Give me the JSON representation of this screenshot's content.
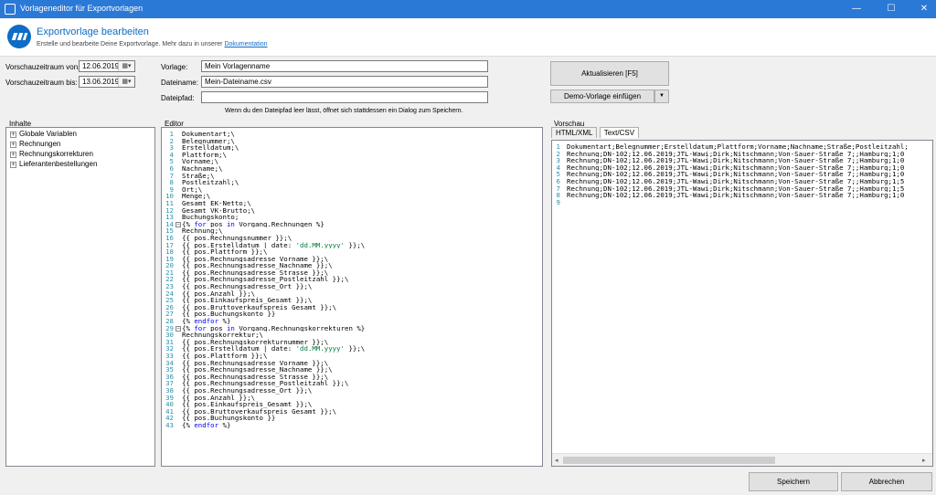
{
  "window": {
    "title": "Vorlageneditor für Exportvorlagen",
    "minimize": "—",
    "maximize": "☐",
    "close": "✕"
  },
  "header": {
    "title": "Exportvorlage bearbeiten",
    "subtitle": "Erstelle und bearbeite Deine Exportvorlage. Mehr dazu in unserer",
    "link": "Dokumentation",
    "brand_color": "#0e6cc4"
  },
  "form": {
    "date_from_label": "Vorschauzeitraum von:",
    "date_from_value": "12.06.2019",
    "date_to_label": "Vorschauzeitraum bis:",
    "date_to_value": "13.06.2019",
    "template_label": "Vorlage:",
    "template_value": "Mein Vorlagenname",
    "filename_label": "Dateiname:",
    "filename_value": "Mein-Dateiname.csv",
    "filepath_label": "Dateipfad:",
    "filepath_value": "",
    "hint": "Wenn du den Dateipfad leer lässt, öffnet sich stattdessen ein Dialog zum Speichern.",
    "refresh_button": "Aktualisieren [F5]",
    "demo_button": "Demo-Vorlage einfügen",
    "demo_arrow": "▼"
  },
  "sections": {
    "contents": "Inhalte",
    "editor": "Editor",
    "preview": "Vorschau"
  },
  "tree": [
    {
      "label": "Globale Variablen"
    },
    {
      "label": "Rechnungen"
    },
    {
      "label": "Rechnungskorrekturen"
    },
    {
      "label": "Lieferantenbestellungen"
    }
  ],
  "editor_lines": [
    {
      "n": "1",
      "t": "Dokumentart;\\"
    },
    {
      "n": "2",
      "t": "Belegnummer;\\"
    },
    {
      "n": "3",
      "t": "Erstelldatum;\\"
    },
    {
      "n": "4",
      "t": "Plattform;\\"
    },
    {
      "n": "5",
      "t": "Vorname;\\"
    },
    {
      "n": "6",
      "t": "Nachname;\\"
    },
    {
      "n": "7",
      "t": "Straße;\\"
    },
    {
      "n": "8",
      "t": "Postleitzahl;\\"
    },
    {
      "n": "9",
      "t": "Ort;\\"
    },
    {
      "n": "10",
      "t": "Menge;\\"
    },
    {
      "n": "11",
      "t": "Gesamt EK-Netto;\\"
    },
    {
      "n": "12",
      "t": "Gesamt VK-Brutto;\\"
    },
    {
      "n": "13",
      "t": "Buchungskonto;"
    },
    {
      "n": "14",
      "fold": true,
      "a": "{% ",
      "k1": "for",
      "b": " pos ",
      "k2": "in",
      "c": " Vorgang.Rechnungen %}"
    },
    {
      "n": "15",
      "t": "Rechnung;\\"
    },
    {
      "n": "16",
      "t": "{{ pos.Rechnungsnummer }};\\"
    },
    {
      "n": "17",
      "a": "{{ pos.Erstelldatum | date: ",
      "s": "'dd.MM.yyyy'",
      "c": " }};\\"
    },
    {
      "n": "18",
      "t": "{{ pos.Plattform }};\\"
    },
    {
      "n": "19",
      "t": "{{ pos.Rechnungsadresse_Vorname }};\\"
    },
    {
      "n": "20",
      "t": "{{ pos.Rechnungsadresse_Nachname }};\\"
    },
    {
      "n": "21",
      "t": "{{ pos.Rechnungsadresse_Strasse }};\\"
    },
    {
      "n": "22",
      "t": "{{ pos.Rechnungsadresse_Postleitzahl }};\\"
    },
    {
      "n": "23",
      "t": "{{ pos.Rechnungsadresse_Ort }};\\"
    },
    {
      "n": "24",
      "t": "{{ pos.Anzahl }};\\"
    },
    {
      "n": "25",
      "t": "{{ pos.Einkaufspreis_Gesamt }};\\"
    },
    {
      "n": "26",
      "t": "{{ pos.Bruttoverkaufspreis_Gesamt }};\\"
    },
    {
      "n": "27",
      "t": "{{ pos.Buchungskonto }}"
    },
    {
      "n": "28",
      "a": "{% ",
      "k1": "endfor",
      "c": " %}"
    },
    {
      "n": "29",
      "fold": true,
      "a": "{% ",
      "k1": "for",
      "b": " pos ",
      "k2": "in",
      "c": " Vorgang.Rechnungskorrekturen %}"
    },
    {
      "n": "30",
      "t": "Rechnungskorrektur;\\"
    },
    {
      "n": "31",
      "t": "{{ pos.Rechnungskorrekturnummer }};\\"
    },
    {
      "n": "32",
      "a": "{{ pos.Erstelldatum | date: ",
      "s": "'dd.MM.yyyy'",
      "c": " }};\\"
    },
    {
      "n": "33",
      "t": "{{ pos.Plattform }};\\"
    },
    {
      "n": "34",
      "t": "{{ pos.Rechnungsadresse_Vorname }};\\"
    },
    {
      "n": "35",
      "t": "{{ pos.Rechnungsadresse_Nachname }};\\"
    },
    {
      "n": "36",
      "t": "{{ pos.Rechnungsadresse_Strasse }};\\"
    },
    {
      "n": "37",
      "t": "{{ pos.Rechnungsadresse_Postleitzahl }};\\"
    },
    {
      "n": "38",
      "t": "{{ pos.Rechnungsadresse_Ort }};\\"
    },
    {
      "n": "39",
      "t": "{{ pos.Anzahl }};\\"
    },
    {
      "n": "40",
      "t": "{{ pos.Einkaufspreis_Gesamt }};\\"
    },
    {
      "n": "41",
      "t": "{{ pos.Bruttoverkaufspreis_Gesamt }};\\"
    },
    {
      "n": "42",
      "t": "{{ pos.Buchungskonto }}"
    },
    {
      "n": "43",
      "a": "{% ",
      "k1": "endfor",
      "c": " %}"
    }
  ],
  "preview": {
    "tabs": [
      "HTML/XML",
      "Text/CSV"
    ],
    "active_tab": "Text/CSV",
    "lines": [
      {
        "n": "1",
        "t": "Dokumentart;Belegnummer;Erstelldatum;Plattform;Vorname;Nachname;Straße;Postleitzahl;"
      },
      {
        "n": "2",
        "t": "Rechnung;DN-102;12.06.2019;JTL-Wawi;Dirk;Nitschmann;Von-Sauer-Straße 7;;Hamburg;1;0"
      },
      {
        "n": "3",
        "t": "Rechnung;DN-102;12.06.2019;JTL-Wawi;Dirk;Nitschmann;Von-Sauer-Straße 7;;Hamburg;1;0"
      },
      {
        "n": "4",
        "t": "Rechnung;DN-102;12.06.2019;JTL-Wawi;Dirk;Nitschmann;Von-Sauer-Straße 7;;Hamburg;1;0"
      },
      {
        "n": "5",
        "t": "Rechnung;DN-102;12.06.2019;JTL-Wawi;Dirk;Nitschmann;Von-Sauer-Straße 7;;Hamburg;1;0"
      },
      {
        "n": "6",
        "t": "Rechnung;DN-102;12.06.2019;JTL-Wawi;Dirk;Nitschmann;Von-Sauer-Straße 7;;Hamburg;1;5"
      },
      {
        "n": "7",
        "t": "Rechnung;DN-102;12.06.2019;JTL-Wawi;Dirk;Nitschmann;Von-Sauer-Straße 7;;Hamburg;1;5"
      },
      {
        "n": "8",
        "t": "Rechnung;DN-102;12.06.2019;JTL-Wawi;Dirk;Nitschmann;Von-Sauer-Straße 7;;Hamburg;1;0"
      },
      {
        "n": "9",
        "t": ""
      }
    ]
  },
  "footer": {
    "save_button": "Speichern",
    "cancel_button": "Abbrechen"
  }
}
